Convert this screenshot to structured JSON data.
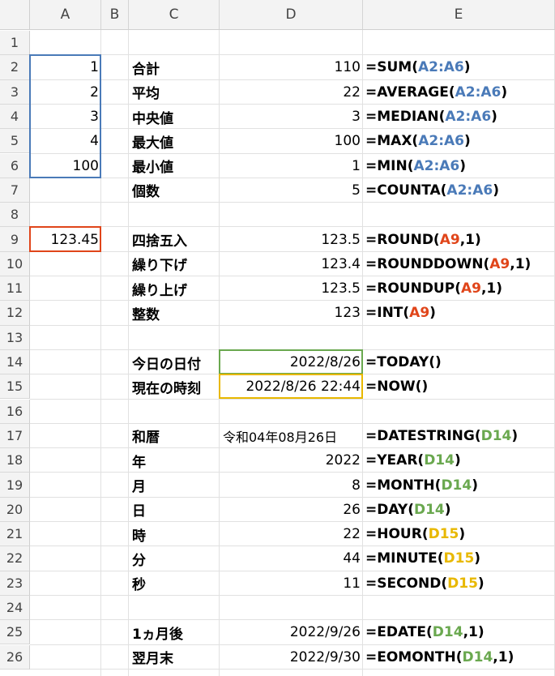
{
  "columns": [
    "A",
    "B",
    "C",
    "D",
    "E"
  ],
  "rows": [
    {
      "n": 1,
      "a": "",
      "c": "",
      "d": "",
      "f": []
    },
    {
      "n": 2,
      "a": "1",
      "c": "合計",
      "d": "110",
      "f": [
        {
          "t": "=SUM("
        },
        {
          "t": "A2:A6",
          "ref": "blue"
        },
        {
          "t": ")"
        }
      ]
    },
    {
      "n": 3,
      "a": "2",
      "c": "平均",
      "d": "22",
      "f": [
        {
          "t": "=AVERAGE("
        },
        {
          "t": "A2:A6",
          "ref": "blue"
        },
        {
          "t": ")"
        }
      ]
    },
    {
      "n": 4,
      "a": "3",
      "c": "中央値",
      "d": "3",
      "f": [
        {
          "t": "=MEDIAN("
        },
        {
          "t": "A2:A6",
          "ref": "blue"
        },
        {
          "t": ")"
        }
      ]
    },
    {
      "n": 5,
      "a": "4",
      "c": "最大値",
      "d": "100",
      "f": [
        {
          "t": "=MAX("
        },
        {
          "t": "A2:A6",
          "ref": "blue"
        },
        {
          "t": ")"
        }
      ]
    },
    {
      "n": 6,
      "a": "100",
      "c": "最小値",
      "d": "1",
      "f": [
        {
          "t": "=MIN("
        },
        {
          "t": "A2:A6",
          "ref": "blue"
        },
        {
          "t": ")"
        }
      ]
    },
    {
      "n": 7,
      "a": "",
      "c": "個数",
      "d": "5",
      "f": [
        {
          "t": "=COUNTA("
        },
        {
          "t": "A2:A6",
          "ref": "blue"
        },
        {
          "t": ")"
        }
      ]
    },
    {
      "n": 8,
      "a": "",
      "c": "",
      "d": "",
      "f": []
    },
    {
      "n": 9,
      "a": "123.45",
      "c": "四捨五入",
      "d": "123.5",
      "f": [
        {
          "t": "=ROUND("
        },
        {
          "t": "A9",
          "ref": "red"
        },
        {
          "t": ",1)"
        }
      ]
    },
    {
      "n": 10,
      "a": "",
      "c": "繰り下げ",
      "d": "123.4",
      "f": [
        {
          "t": "=ROUNDDOWN("
        },
        {
          "t": "A9",
          "ref": "red"
        },
        {
          "t": ",1)"
        }
      ]
    },
    {
      "n": 11,
      "a": "",
      "c": "繰り上げ",
      "d": "123.5",
      "f": [
        {
          "t": "=ROUNDUP("
        },
        {
          "t": "A9",
          "ref": "red"
        },
        {
          "t": ",1)"
        }
      ]
    },
    {
      "n": 12,
      "a": "",
      "c": "整数",
      "d": "123",
      "f": [
        {
          "t": "=INT("
        },
        {
          "t": "A9",
          "ref": "red"
        },
        {
          "t": ")"
        }
      ]
    },
    {
      "n": 13,
      "a": "",
      "c": "",
      "d": "",
      "f": []
    },
    {
      "n": 14,
      "a": "",
      "c": "今日の日付",
      "d": "2022/8/26",
      "f": [
        {
          "t": "=TODAY()"
        }
      ]
    },
    {
      "n": 15,
      "a": "",
      "c": "現在の時刻",
      "d": "2022/8/26 22:44",
      "f": [
        {
          "t": "=NOW()"
        }
      ]
    },
    {
      "n": 16,
      "a": "",
      "c": "",
      "d": "",
      "f": []
    },
    {
      "n": 17,
      "a": "",
      "c": "和暦",
      "d": "令和04年08月26日",
      "dAlign": "left",
      "f": [
        {
          "t": "=DATESTRING("
        },
        {
          "t": "D14",
          "ref": "green"
        },
        {
          "t": ")"
        }
      ]
    },
    {
      "n": 18,
      "a": "",
      "c": "年",
      "d": "2022",
      "f": [
        {
          "t": "=YEAR("
        },
        {
          "t": "D14",
          "ref": "green"
        },
        {
          "t": ")"
        }
      ]
    },
    {
      "n": 19,
      "a": "",
      "c": "月",
      "d": "8",
      "f": [
        {
          "t": "=MONTH("
        },
        {
          "t": "D14",
          "ref": "green"
        },
        {
          "t": ")"
        }
      ]
    },
    {
      "n": 20,
      "a": "",
      "c": "日",
      "d": "26",
      "f": [
        {
          "t": "=DAY("
        },
        {
          "t": "D14",
          "ref": "green"
        },
        {
          "t": ")"
        }
      ]
    },
    {
      "n": 21,
      "a": "",
      "c": "時",
      "d": "22",
      "f": [
        {
          "t": "=HOUR("
        },
        {
          "t": "D15",
          "ref": "gold"
        },
        {
          "t": ")"
        }
      ]
    },
    {
      "n": 22,
      "a": "",
      "c": "分",
      "d": "44",
      "f": [
        {
          "t": "=MINUTE("
        },
        {
          "t": "D15",
          "ref": "gold"
        },
        {
          "t": ")"
        }
      ]
    },
    {
      "n": 23,
      "a": "",
      "c": "秒",
      "d": "11",
      "f": [
        {
          "t": "=SECOND("
        },
        {
          "t": "D15",
          "ref": "gold"
        },
        {
          "t": ")"
        }
      ]
    },
    {
      "n": 24,
      "a": "",
      "c": "",
      "d": "",
      "f": []
    },
    {
      "n": 25,
      "a": "",
      "c": "1ヵ月後",
      "d": "2022/9/26",
      "f": [
        {
          "t": "=EDATE("
        },
        {
          "t": "D14",
          "ref": "green"
        },
        {
          "t": ",1)"
        }
      ]
    },
    {
      "n": 26,
      "a": "",
      "c": "翌月末",
      "d": "2022/9/30",
      "f": [
        {
          "t": "=EOMONTH("
        },
        {
          "t": "D14",
          "ref": "green"
        },
        {
          "t": ",1)"
        }
      ]
    }
  ],
  "colors": {
    "blue": "#4a7ab8",
    "red": "#e0451a",
    "green": "#6aa84f",
    "gold": "#e8b800"
  }
}
